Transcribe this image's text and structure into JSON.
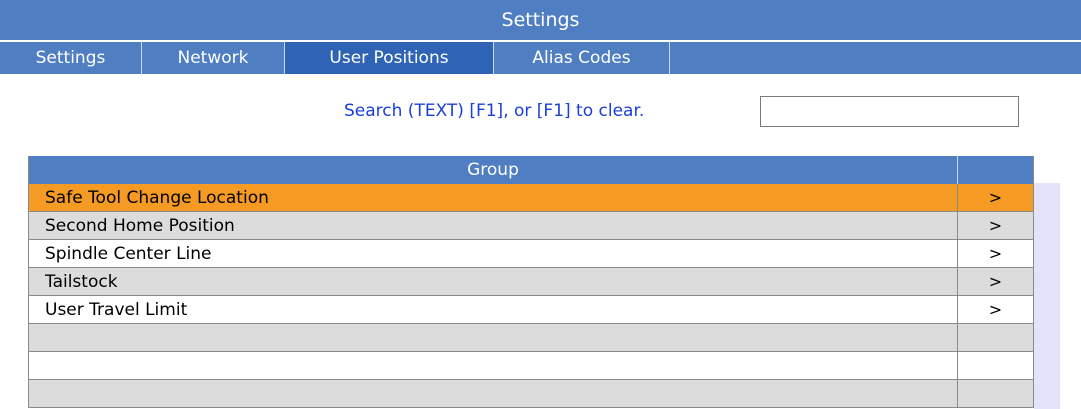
{
  "title": "Settings",
  "tabs": [
    {
      "label": "Settings"
    },
    {
      "label": "Network"
    },
    {
      "label": "User Positions"
    },
    {
      "label": "Alias Codes"
    }
  ],
  "active_tab": "User Positions",
  "search": {
    "label": "Search (TEXT) [F1], or [F1] to clear.",
    "value": ""
  },
  "table": {
    "header": "Group",
    "rows": [
      {
        "name": "Safe Tool Change Location",
        "arrow": ">"
      },
      {
        "name": "Second Home Position",
        "arrow": ">"
      },
      {
        "name": "Spindle Center Line",
        "arrow": ">"
      },
      {
        "name": "Tailstock",
        "arrow": ">"
      },
      {
        "name": "User Travel Limit",
        "arrow": ">"
      },
      {
        "name": "",
        "arrow": ""
      },
      {
        "name": "",
        "arrow": ""
      },
      {
        "name": "",
        "arrow": ""
      }
    ]
  },
  "colors": {
    "title_bar": "#4f7ec3",
    "active_tab": "#2e63b5",
    "selected_row": "#f59a23",
    "search_text": "#1a3fd6"
  }
}
